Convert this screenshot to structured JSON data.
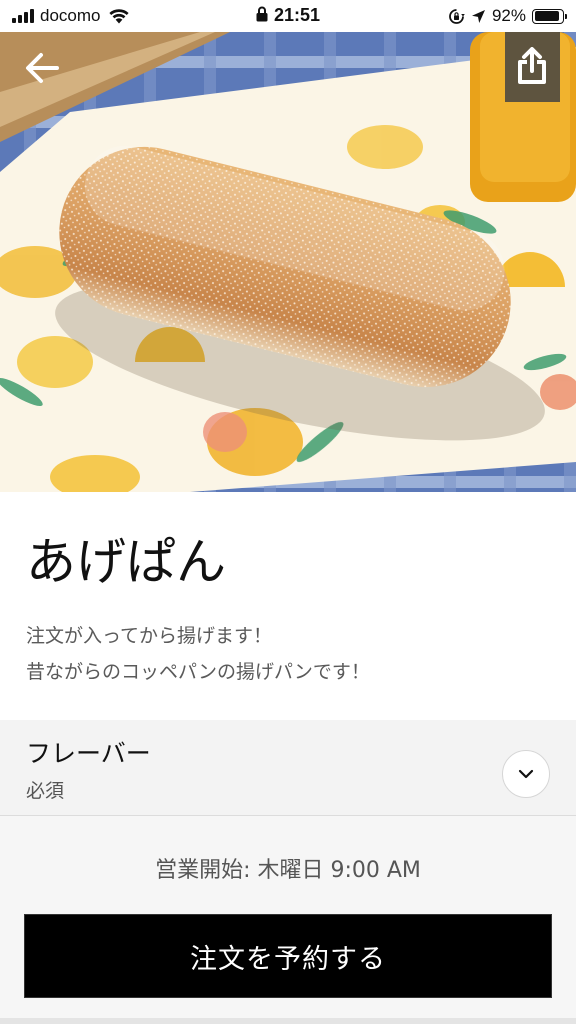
{
  "status_bar": {
    "carrier": "docomo",
    "time": "21:51",
    "battery": "92%",
    "battery_level": 0.92,
    "icons": [
      "signal-icon",
      "wifi-icon",
      "lock-icon",
      "rotation-lock-icon",
      "location-arrow-icon",
      "battery-icon"
    ]
  },
  "hero": {
    "icons": [
      "back-arrow-icon",
      "share-icon"
    ]
  },
  "item": {
    "title": "あげぱん",
    "description_line1": "注文が入ってから揚げます！",
    "description_line2": "昔ながらのコッペパンの揚げパンです！"
  },
  "options": {
    "title": "フレーバー",
    "required_label": "必須",
    "toggle_icon": "chevron-down-icon"
  },
  "footer": {
    "hours": "営業開始: 木曜日 9:00 AM",
    "order_button": "注文を予約する"
  },
  "colors": {
    "button_bg": "#000000",
    "option_bg": "#f3f3f3",
    "sheet_bg": "#f6f6f6"
  }
}
